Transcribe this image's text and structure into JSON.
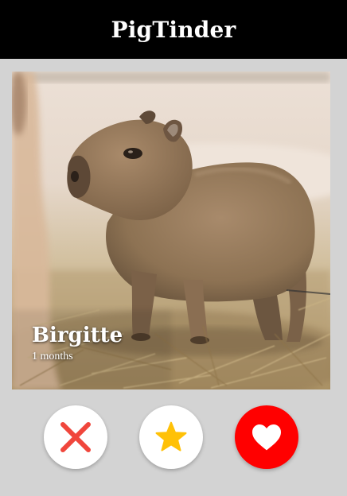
{
  "app": {
    "title": "PigTinder"
  },
  "profile": {
    "name": "Birgitte",
    "age": "1 months",
    "photo": "capybara-photo"
  },
  "actions": {
    "nope_icon": "close-icon",
    "superlike_icon": "star-icon",
    "like_icon": "heart-icon"
  },
  "colors": {
    "header_bg": "#000000",
    "page_bg": "#d3d3d3",
    "nope": "#f0463c",
    "superlike": "#ffc107",
    "like": "#ff0000"
  }
}
